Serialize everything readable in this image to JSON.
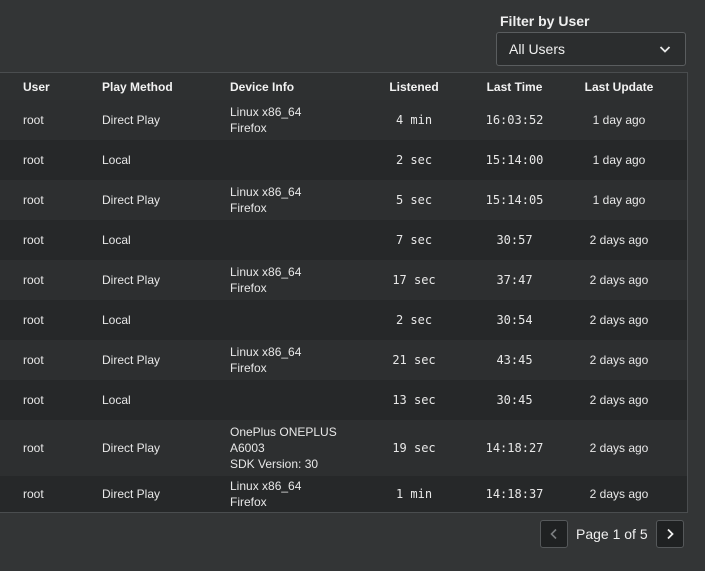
{
  "filter": {
    "label": "Filter by User",
    "selected": "All Users"
  },
  "table": {
    "headers": {
      "user": "User",
      "method": "Play Method",
      "device": "Device Info",
      "listened": "Listened",
      "last_time": "Last Time",
      "last_update": "Last Update"
    },
    "rows": [
      {
        "user": "root",
        "method": "Direct Play",
        "device1": "Linux x86_64",
        "device2": "Firefox",
        "device3": "",
        "listened": "4 min",
        "last_time": "16:03:52",
        "last_update": "1 day ago"
      },
      {
        "user": "root",
        "method": "Local",
        "device1": "",
        "device2": "",
        "device3": "",
        "listened": "2 sec",
        "last_time": "15:14:00",
        "last_update": "1 day ago"
      },
      {
        "user": "root",
        "method": "Direct Play",
        "device1": "Linux x86_64",
        "device2": "Firefox",
        "device3": "",
        "listened": "5 sec",
        "last_time": "15:14:05",
        "last_update": "1 day ago"
      },
      {
        "user": "root",
        "method": "Local",
        "device1": "",
        "device2": "",
        "device3": "",
        "listened": "7 sec",
        "last_time": "30:57",
        "last_update": "2 days ago"
      },
      {
        "user": "root",
        "method": "Direct Play",
        "device1": "Linux x86_64",
        "device2": "Firefox",
        "device3": "",
        "listened": "17 sec",
        "last_time": "37:47",
        "last_update": "2 days ago"
      },
      {
        "user": "root",
        "method": "Local",
        "device1": "",
        "device2": "",
        "device3": "",
        "listened": "2 sec",
        "last_time": "30:54",
        "last_update": "2 days ago"
      },
      {
        "user": "root",
        "method": "Direct Play",
        "device1": "Linux x86_64",
        "device2": "Firefox",
        "device3": "",
        "listened": "21 sec",
        "last_time": "43:45",
        "last_update": "2 days ago"
      },
      {
        "user": "root",
        "method": "Local",
        "device1": "",
        "device2": "",
        "device3": "",
        "listened": "13 sec",
        "last_time": "30:45",
        "last_update": "2 days ago"
      },
      {
        "user": "root",
        "method": "Direct Play",
        "device1": "OnePlus ONEPLUS",
        "device2": "A6003",
        "device3": "SDK Version: 30",
        "listened": "19 sec",
        "last_time": "14:18:27",
        "last_update": "2 days ago"
      },
      {
        "user": "root",
        "method": "Direct Play",
        "device1": "Linux x86_64",
        "device2": "Firefox",
        "device3": "",
        "listened": "1 min",
        "last_time": "14:18:37",
        "last_update": "2 days ago"
      }
    ]
  },
  "pagination": {
    "text": "Page 1 of 5",
    "prev_icon": "chevron-left-icon",
    "next_icon": "chevron-right-icon"
  },
  "colors": {
    "background": "#333536",
    "row_odd": "#2d2f30",
    "row_even": "#262829"
  }
}
